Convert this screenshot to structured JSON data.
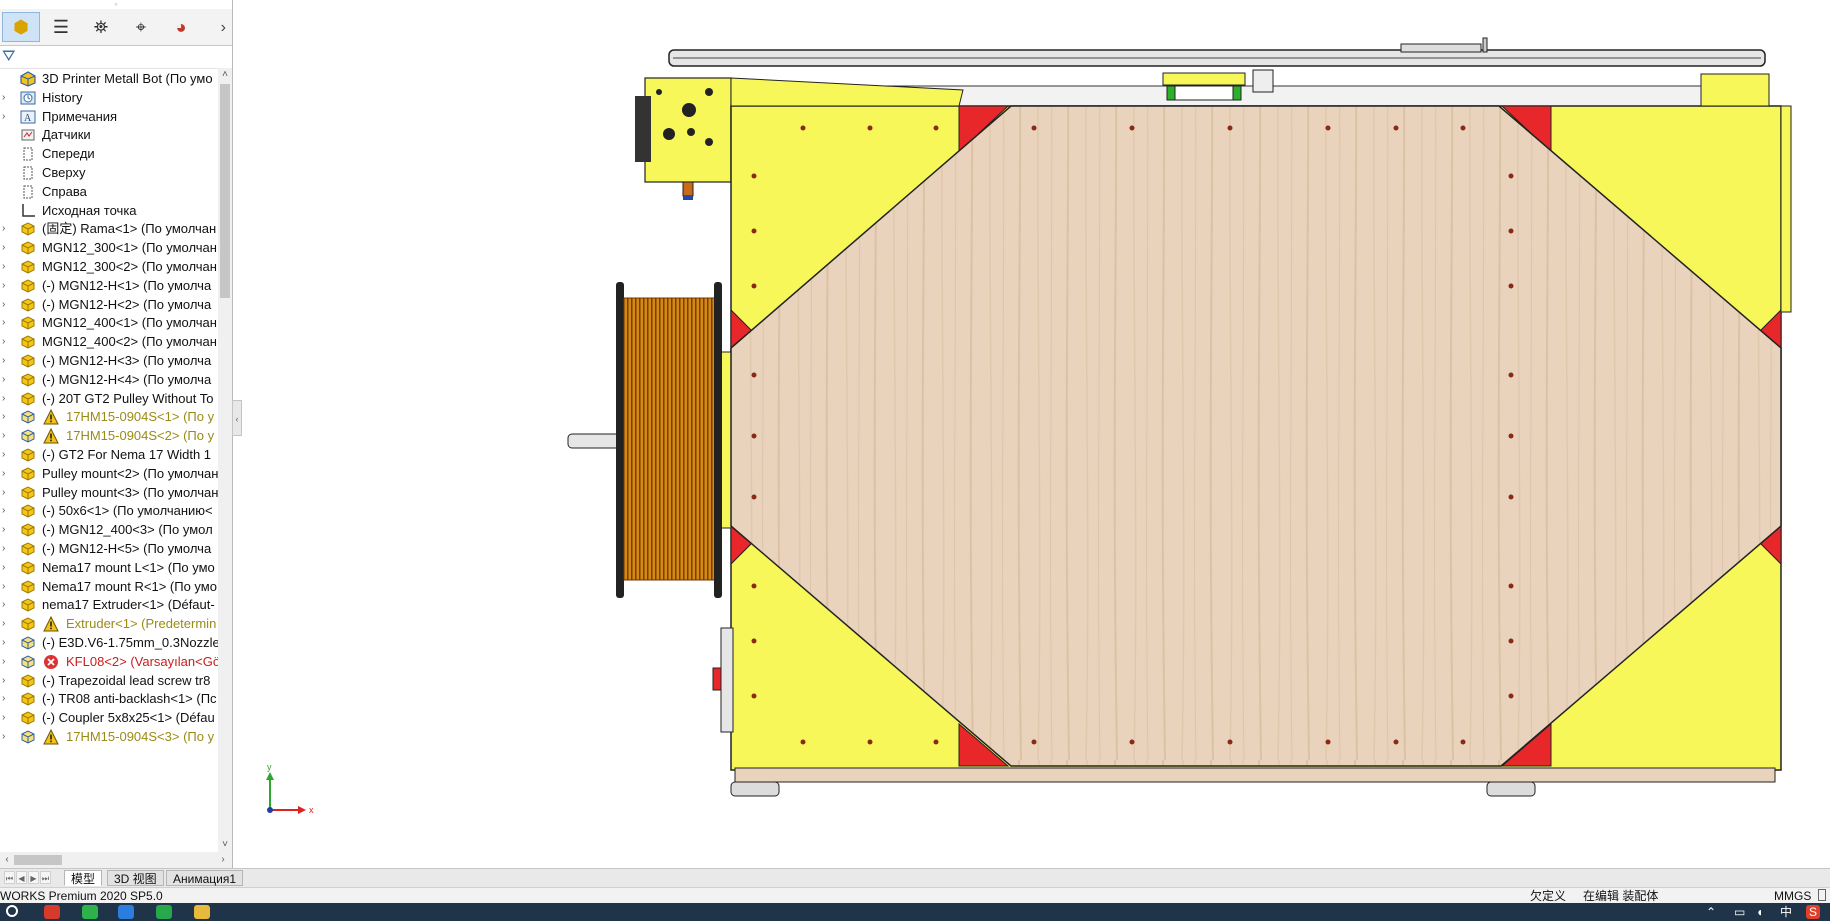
{
  "sidebar": {
    "tabs": [
      {
        "name": "feature-manager-tab",
        "glyph": "⬢",
        "active": true
      },
      {
        "name": "property-manager-tab",
        "glyph": "☰",
        "active": false
      },
      {
        "name": "configuration-manager-tab",
        "glyph": "⛯",
        "active": false
      },
      {
        "name": "dimxpert-manager-tab",
        "glyph": "⌖",
        "active": false
      },
      {
        "name": "display-manager-tab",
        "glyph": "◕",
        "active": false
      }
    ],
    "more_glyph": "›",
    "filter_glyph": "⛛",
    "tree": [
      {
        "label": "3D Printer Metall Bot  (По умо",
        "icon": "assembly-icon",
        "expander": "",
        "status": "",
        "top": true
      },
      {
        "label": "History",
        "icon": "history-icon",
        "expander": "›",
        "status": ""
      },
      {
        "label": "Примечания",
        "icon": "annotations-icon",
        "expander": "›",
        "status": ""
      },
      {
        "label": "Датчики",
        "icon": "sensors-icon",
        "expander": "",
        "status": ""
      },
      {
        "label": "Спереди",
        "icon": "plane-icon",
        "expander": "",
        "status": ""
      },
      {
        "label": "Сверху",
        "icon": "plane-icon",
        "expander": "",
        "status": ""
      },
      {
        "label": "Справа",
        "icon": "plane-icon",
        "expander": "",
        "status": ""
      },
      {
        "label": "Исходная точка",
        "icon": "origin-icon",
        "expander": "",
        "status": ""
      },
      {
        "label": "(固定) Rama<1> (По умолчан",
        "icon": "subassembly-icon",
        "expander": "›",
        "status": ""
      },
      {
        "label": "MGN12_300<1> (По умолчан",
        "icon": "subassembly-icon",
        "expander": "›",
        "status": ""
      },
      {
        "label": "MGN12_300<2> (По умолчан",
        "icon": "subassembly-icon",
        "expander": "›",
        "status": ""
      },
      {
        "label": "(-) MGN12-H<1> (По умолча",
        "icon": "subassembly-icon",
        "expander": "›",
        "status": ""
      },
      {
        "label": "(-) MGN12-H<2> (По умолча",
        "icon": "subassembly-icon",
        "expander": "›",
        "status": ""
      },
      {
        "label": "MGN12_400<1> (По умолчан",
        "icon": "subassembly-icon",
        "expander": "›",
        "status": ""
      },
      {
        "label": "MGN12_400<2> (По умолчан",
        "icon": "subassembly-icon",
        "expander": "›",
        "status": ""
      },
      {
        "label": "(-) MGN12-H<3> (По умолча",
        "icon": "subassembly-icon",
        "expander": "›",
        "status": ""
      },
      {
        "label": "(-) MGN12-H<4> (По умолча",
        "icon": "subassembly-icon",
        "expander": "›",
        "status": ""
      },
      {
        "label": "(-) 20T GT2  Pulley Without To",
        "icon": "subassembly-icon",
        "expander": "›",
        "status": ""
      },
      {
        "label": "17HM15-0904S<1> (По у",
        "icon": "part-icon",
        "expander": "›",
        "status": "warn"
      },
      {
        "label": "17HM15-0904S<2> (По у",
        "icon": "part-icon",
        "expander": "›",
        "status": "warn"
      },
      {
        "label": "(-) GT2  For Nema 17  Width 1",
        "icon": "subassembly-icon",
        "expander": "›",
        "status": ""
      },
      {
        "label": "Pulley mount<2> (По умолчан",
        "icon": "subassembly-icon",
        "expander": "›",
        "status": ""
      },
      {
        "label": "Pulley mount<3> (По умолчан",
        "icon": "subassembly-icon",
        "expander": "›",
        "status": ""
      },
      {
        "label": "(-) 50x6<1> (По умолчанию<",
        "icon": "subassembly-icon",
        "expander": "›",
        "status": ""
      },
      {
        "label": "(-) MGN12_400<3> (По умол",
        "icon": "subassembly-icon",
        "expander": "›",
        "status": ""
      },
      {
        "label": "(-) MGN12-H<5> (По умолча",
        "icon": "subassembly-icon",
        "expander": "›",
        "status": ""
      },
      {
        "label": "Nema17 mount L<1> (По умо",
        "icon": "subassembly-icon",
        "expander": "›",
        "status": ""
      },
      {
        "label": "Nema17 mount R<1> (По умо",
        "icon": "subassembly-icon",
        "expander": "›",
        "status": ""
      },
      {
        "label": "nema17 Extruder<1> (Défaut-",
        "icon": "subassembly-icon",
        "expander": "›",
        "status": ""
      },
      {
        "label": "Extruder<1> (Predetermin",
        "icon": "subassembly-icon",
        "expander": "›",
        "status": "warn"
      },
      {
        "label": "(-) E3D.V6-1.75mm_0.3Nozzle_",
        "icon": "part-icon",
        "expander": "›",
        "status": ""
      },
      {
        "label": "KFL08<2> (Varsayılan<Gö",
        "icon": "part-icon",
        "expander": "›",
        "status": "err"
      },
      {
        "label": "(-) Trapezoidal lead screw tr8",
        "icon": "subassembly-icon",
        "expander": "›",
        "status": ""
      },
      {
        "label": "(-) TR08 anti-backlash<1> (Пс",
        "icon": "subassembly-icon",
        "expander": "›",
        "status": ""
      },
      {
        "label": "(-) Coupler 5x8x25<1> (Défau",
        "icon": "subassembly-icon",
        "expander": "›",
        "status": ""
      },
      {
        "label": "17HM15-0904S<3> (По у",
        "icon": "part-icon",
        "expander": "›",
        "status": "warn"
      }
    ]
  },
  "bottom_tabs": [
    "模型",
    "3D 视图",
    "Анимация1"
  ],
  "status": {
    "app": "WORKS Premium 2020 SP5.0",
    "state1": "欠定义",
    "state2": "在编辑 装配体",
    "units": "MMGS"
  },
  "taskbar": {
    "ime": "中",
    "lang": "S"
  },
  "triad": {
    "x": "x",
    "y": "y"
  },
  "colors": {
    "panel_yellow": "#f7f75a",
    "accent_red": "#e8272a",
    "plate_wood": "#e9d3bc",
    "spool_orange": "#d48a12",
    "warning": "#9a8b16",
    "error": "#c81e1e",
    "taskbar": "#1f3349"
  }
}
